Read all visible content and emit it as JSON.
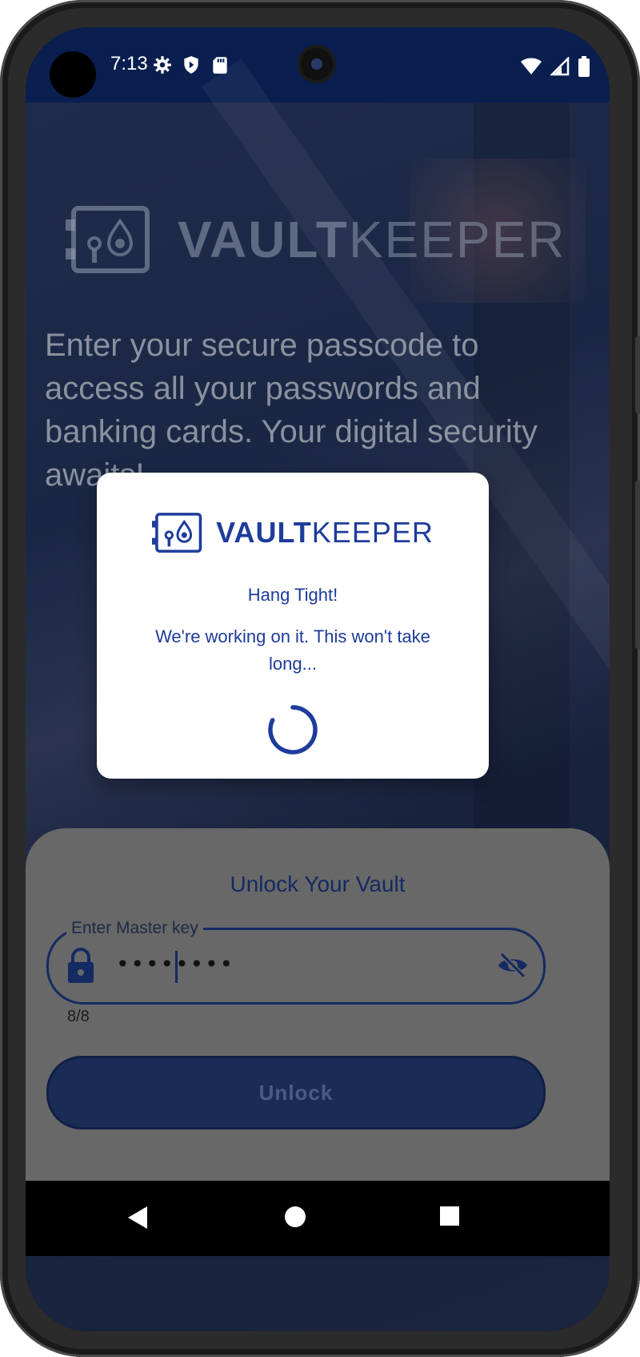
{
  "status_bar": {
    "time": "7:13"
  },
  "app": {
    "brand_bold": "VAULT",
    "brand_light": "KEEPER",
    "tagline": "Enter your secure passcode to access all your passwords and banking cards. Your digital security awaits!"
  },
  "sheet": {
    "title": "Unlock Your Vault",
    "field_label": "Enter Master key",
    "field_value": "••••••••",
    "counter": "8/8",
    "unlock_label": "Unlock"
  },
  "dialog": {
    "brand_bold": "VAULT",
    "brand_light": "KEEPER",
    "title": "Hang Tight!",
    "message": "We're working on it. This won't take long..."
  },
  "colors": {
    "status_bar": "#0a1f4f",
    "brand_blue": "#1e3c9c",
    "sheet_bg": "#686868",
    "button_bg": "#1a2c55"
  },
  "icons": {
    "status": [
      "gear-icon",
      "shield-icon",
      "sd-card-icon"
    ],
    "status_right": [
      "wifi-icon",
      "signal-icon",
      "battery-icon"
    ],
    "field": [
      "lock-icon",
      "eye-off-icon"
    ],
    "nav": [
      "back-icon",
      "home-icon",
      "recents-icon"
    ]
  }
}
